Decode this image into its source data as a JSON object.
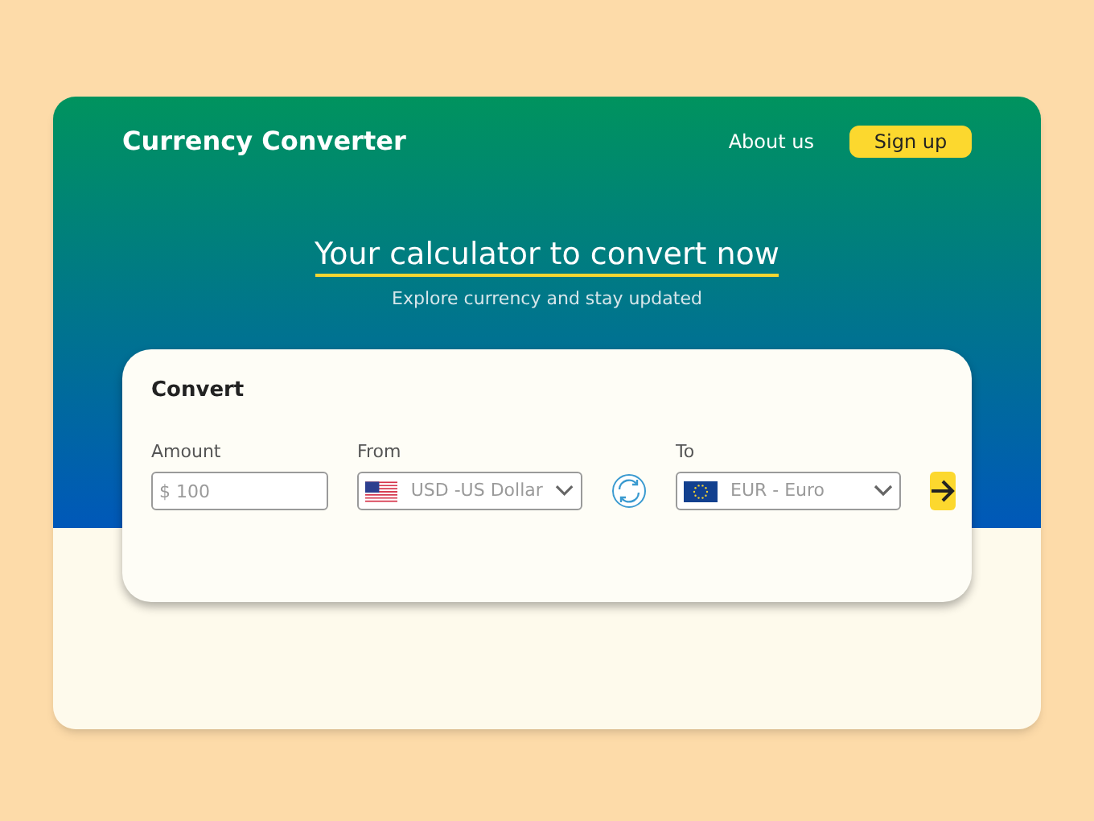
{
  "header": {
    "brand": "Currency Converter",
    "nav": [
      {
        "label": "About us",
        "kind": "link"
      },
      {
        "label": "Sign up",
        "kind": "button"
      }
    ]
  },
  "hero": {
    "title": "Your calculator to convert now",
    "subtitle": "Explore currency and stay updated"
  },
  "converter": {
    "title": "Convert",
    "amount": {
      "label": "Amount",
      "placeholder": "$ 100"
    },
    "from": {
      "label": "From",
      "value": "USD -US Dollar",
      "kind": "us"
    },
    "to": {
      "label": "To",
      "value": "EUR - Euro",
      "kind": "eu"
    }
  }
}
